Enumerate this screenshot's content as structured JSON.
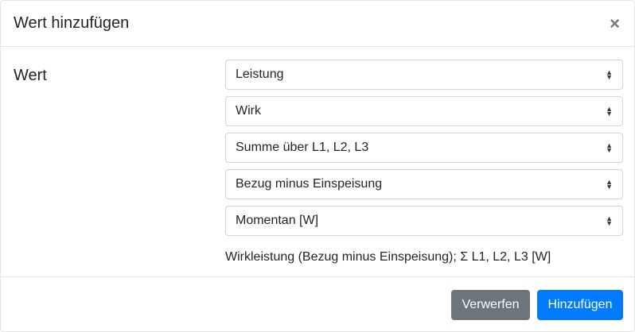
{
  "title": "Wert hinzufügen",
  "close_symbol": "×",
  "label": "Wert",
  "selects": [
    "Leistung",
    "Wirk",
    "Summe über L1, L2, L3",
    "Bezug minus Einspeisung",
    "Momentan [W]"
  ],
  "help": "Wirkleistung (Bezug minus Einspeisung); Σ L1, L2, L3 [W]",
  "buttons": {
    "discard": "Verwerfen",
    "add": "Hinzufügen"
  },
  "colors": {
    "primary": "#007bff",
    "secondary": "#6c757d"
  }
}
